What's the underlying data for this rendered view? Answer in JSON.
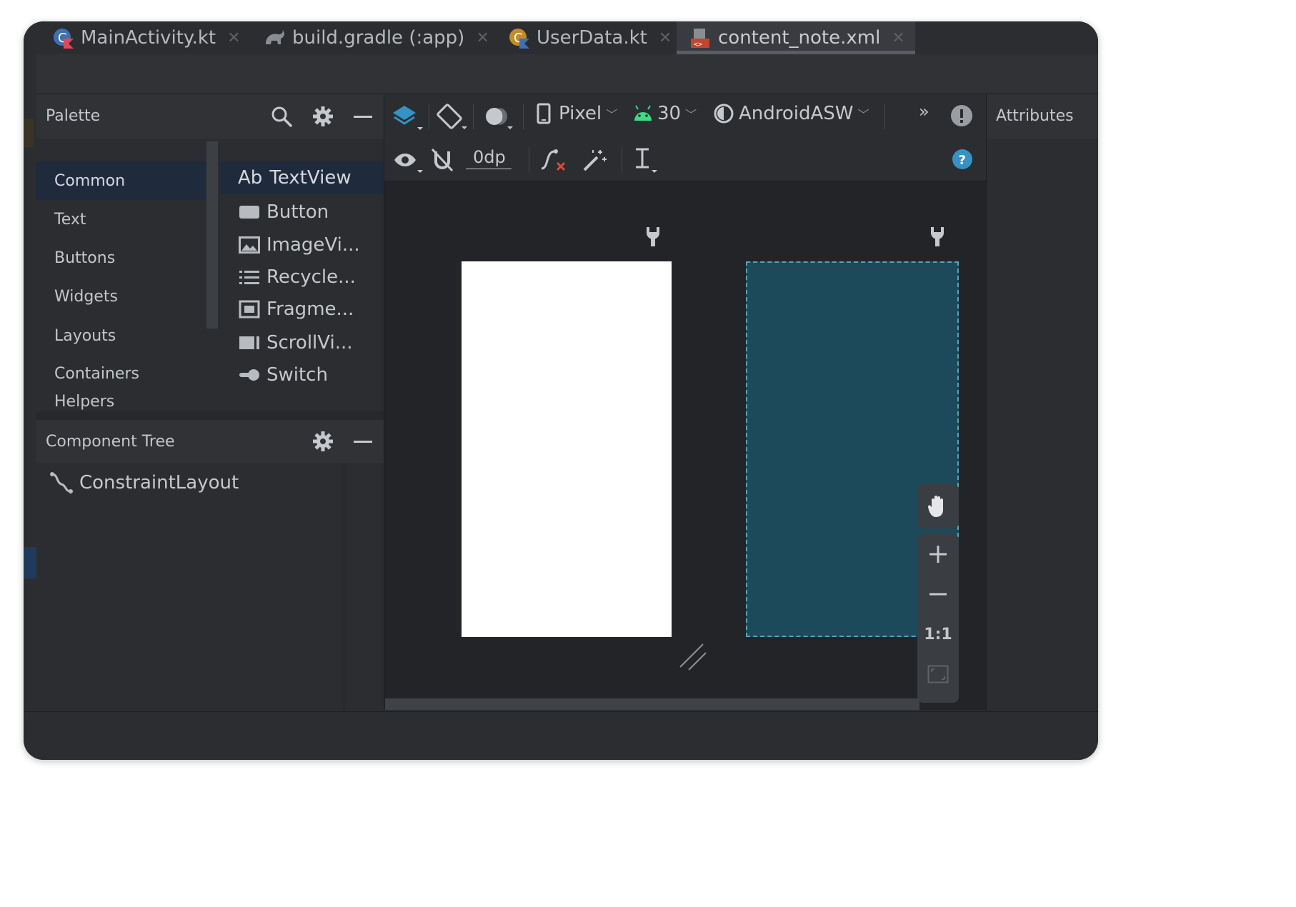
{
  "tabs": [
    {
      "label": "MainActivity.kt",
      "icon": "kotlin-class-icon",
      "active": false
    },
    {
      "label": "build.gradle (:app)",
      "icon": "gradle-elephant-icon",
      "active": false
    },
    {
      "label": "UserData.kt",
      "icon": "kotlin-class-icon",
      "active": false
    },
    {
      "label": "content_note.xml",
      "icon": "layout-xml-icon",
      "active": true
    }
  ],
  "palette": {
    "title": "Palette",
    "categories": [
      "Common",
      "Text",
      "Buttons",
      "Widgets",
      "Layouts",
      "Containers",
      "Helpers"
    ],
    "selected_category": "Common",
    "components": [
      {
        "label": "TextView",
        "icon_text": "Ab"
      },
      {
        "label": "Button"
      },
      {
        "label": "ImageVi..."
      },
      {
        "label": "Recycle..."
      },
      {
        "label": "Fragme..."
      },
      {
        "label": "ScrollVi..."
      },
      {
        "label": "Switch"
      }
    ]
  },
  "component_tree": {
    "title": "Component Tree",
    "root": "ConstraintLayout"
  },
  "toolbar": {
    "device": "Pixel",
    "api_level": "30",
    "theme": "AndroidASW",
    "overflow": "»",
    "default_margin": "0dp"
  },
  "zoom": {
    "one_to_one": "1:1"
  },
  "attributes": {
    "title": "Attributes"
  },
  "colors": {
    "background": "#2b2d30",
    "selection": "#1f2a3d",
    "blueprint": "#1c4a5a",
    "accent_blue": "#3592c4",
    "android_green": "#3ddc84"
  }
}
